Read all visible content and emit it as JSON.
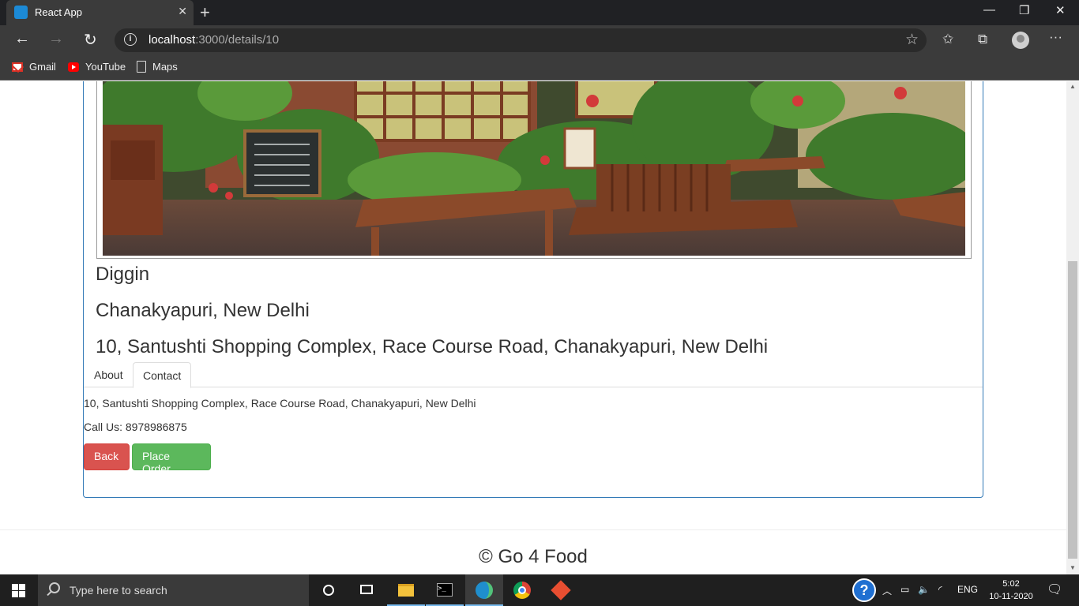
{
  "browser": {
    "tab_title": "React App",
    "url_host": "localhost",
    "url_path": ":3000/details/10",
    "bookmarks": [
      "Gmail",
      "YouTube",
      "Maps"
    ]
  },
  "restaurant": {
    "name": "Diggin",
    "locality": "Chanakyapuri, New Delhi",
    "address": "10, Santushti Shopping Complex, Race Course Road, Chanakyapuri, New Delhi"
  },
  "tabs": [
    {
      "label": "About",
      "active": false
    },
    {
      "label": "Contact",
      "active": true
    }
  ],
  "contact": {
    "address": "10, Santushti Shopping Complex, Race Course Road, Chanakyapuri, New Delhi",
    "phone": "Call Us: 8978986875"
  },
  "buttons": {
    "back": "Back",
    "place_order": "Place Order"
  },
  "footer": {
    "text": "© Go 4 Food"
  },
  "taskbar": {
    "search_placeholder": "Type here to search",
    "language": "ENG",
    "time": "5:02",
    "date": "10-11-2020"
  }
}
